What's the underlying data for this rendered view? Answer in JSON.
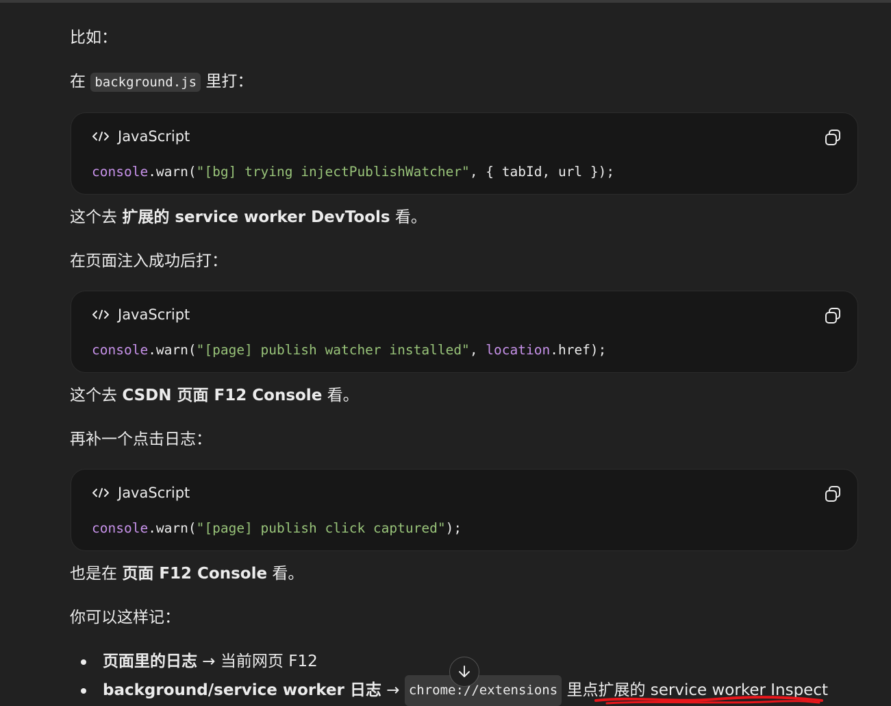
{
  "texts": {
    "p1": "比如：",
    "p2_pre": "在 ",
    "p2_code": "background.js",
    "p2_post": " 里打：",
    "p3_pre": "这个去 ",
    "p3_bold": "扩展的 service worker DevTools",
    "p3_post": " 看。",
    "p4": "在页面注入成功后打：",
    "p5_pre": "这个去 ",
    "p5_bold": "CSDN 页面 F12 Console",
    "p5_post": " 看。",
    "p6": "再补一个点击日志：",
    "p7_pre": "也是在 ",
    "p7_bold": "页面 F12 Console",
    "p7_post": " 看。",
    "p8": "你可以这样记："
  },
  "code_blocks": [
    {
      "language": "JavaScript",
      "tokens": {
        "obj": "console",
        "method": ".warn(",
        "str": "\"[bg] trying injectPublishWatcher\"",
        "rest": ", { tabId, url });"
      }
    },
    {
      "language": "JavaScript",
      "tokens": {
        "obj": "console",
        "method": ".warn(",
        "str": "\"[page] publish watcher installed\"",
        "sep": ", ",
        "obj2": "location",
        "rest": ".href);"
      }
    },
    {
      "language": "JavaScript",
      "tokens": {
        "obj": "console",
        "method": ".warn(",
        "str": "\"[page] publish click captured\"",
        "rest": ");"
      }
    }
  ],
  "bullets": [
    {
      "bold": "页面里的日志",
      "arrow": " → ",
      "text": "当前网页 F12"
    },
    {
      "bold": "background/service worker 日志",
      "arrow": " → ",
      "code": "chrome://extensions",
      "text": " 里点扩展的 service worker Inspect"
    }
  ],
  "icons": {
    "code": "code-brackets-icon",
    "copy": "copy-icon",
    "scroll": "arrow-down-icon"
  },
  "colors": {
    "background": "#212121",
    "code_bg": "#171717",
    "string": "#98c379",
    "keyword": "#c792ea",
    "annotation": "#e8161b"
  }
}
